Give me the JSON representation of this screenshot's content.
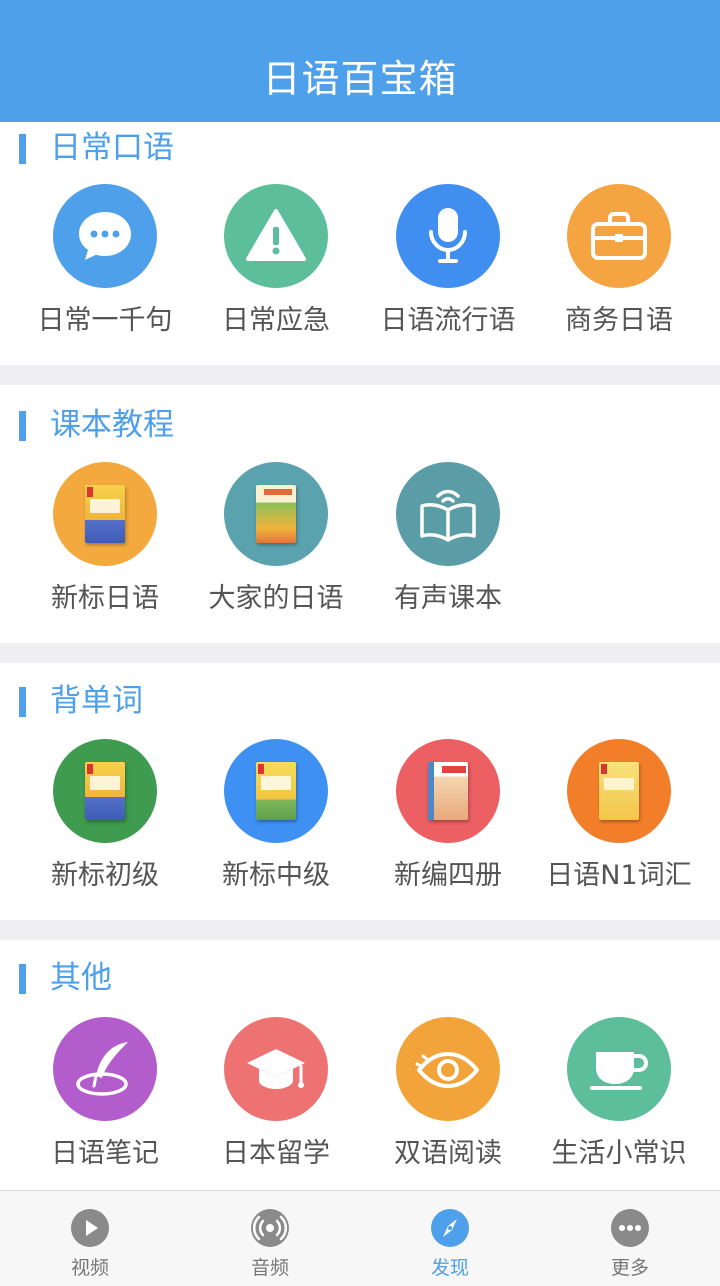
{
  "header": {
    "title": "日语百宝箱"
  },
  "sections": [
    {
      "title": "日常口语",
      "items": [
        {
          "label": "日常一千句",
          "icon": "chat-bubble-icon",
          "color": "#4FA0EA"
        },
        {
          "label": "日常应急",
          "icon": "warning-icon",
          "color": "#5CBE9A"
        },
        {
          "label": "日语流行语",
          "icon": "microphone-icon",
          "color": "#3F8EF0"
        },
        {
          "label": "商务日语",
          "icon": "briefcase-icon",
          "color": "#F5A442"
        }
      ]
    },
    {
      "title": "课本教程",
      "items": [
        {
          "label": "新标日语",
          "icon": "textbook-cover-icon",
          "color": "#F4A93E"
        },
        {
          "label": "大家的日语",
          "icon": "textbook-cover-icon",
          "color": "#5AA2AE"
        },
        {
          "label": "有声课本",
          "icon": "audio-book-icon",
          "color": "#5B9DA6"
        }
      ]
    },
    {
      "title": "背单词",
      "items": [
        {
          "label": "新标初级",
          "icon": "textbook-cover-icon",
          "color": "#3E9B4F"
        },
        {
          "label": "新标中级",
          "icon": "textbook-cover-icon",
          "color": "#3E91F2"
        },
        {
          "label": "新编四册",
          "icon": "textbook-cover-icon",
          "color": "#EC5F63"
        },
        {
          "label": "日语N1词汇",
          "icon": "textbook-cover-icon",
          "color": "#F37E2A"
        }
      ]
    },
    {
      "title": "其他",
      "items": [
        {
          "label": "日语笔记",
          "icon": "feather-pen-icon",
          "color": "#B35CCB"
        },
        {
          "label": "日本留学",
          "icon": "graduation-cap-icon",
          "color": "#EE7272"
        },
        {
          "label": "双语阅读",
          "icon": "eye-icon",
          "color": "#F2A43B"
        },
        {
          "label": "生活小常识",
          "icon": "coffee-cup-icon",
          "color": "#5CBE9A"
        }
      ]
    }
  ],
  "tabbar": {
    "active": "发现",
    "active_color": "#4FA0EA",
    "tabs": [
      {
        "label": "视频",
        "icon": "play-icon"
      },
      {
        "label": "音频",
        "icon": "broadcast-icon"
      },
      {
        "label": "发现",
        "icon": "compass-icon"
      },
      {
        "label": "更多",
        "icon": "more-dots-icon"
      }
    ]
  }
}
